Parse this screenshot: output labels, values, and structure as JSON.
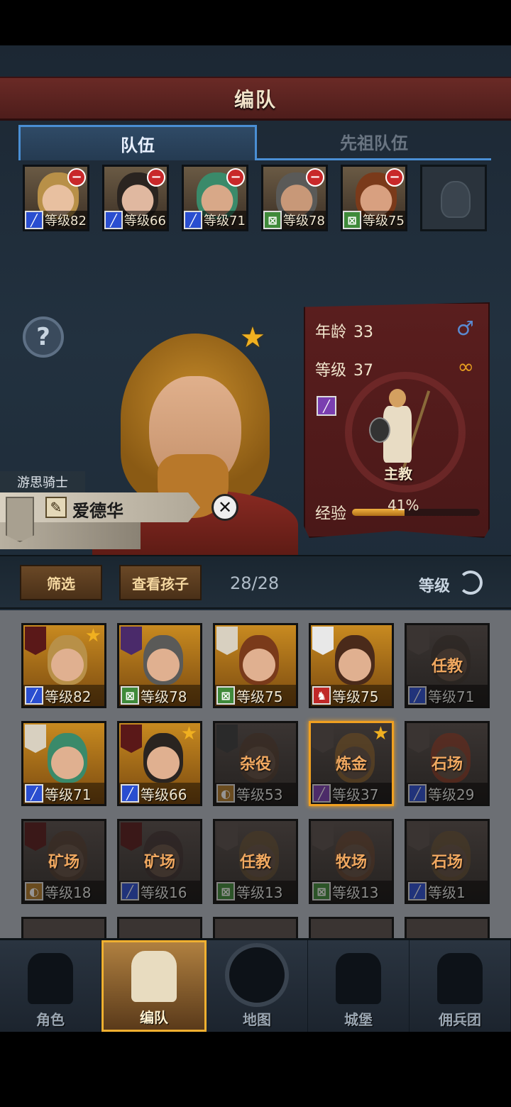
{
  "header": {
    "title": "编队"
  },
  "tabs": [
    {
      "label": "队伍",
      "active": true
    },
    {
      "label": "先祖队伍",
      "active": false
    }
  ],
  "team": [
    {
      "level_text": "等级82",
      "class_icon": "sword-icon",
      "hair": "#b89048",
      "skin": "#e8c0a0"
    },
    {
      "level_text": "等级66",
      "class_icon": "sword-icon",
      "hair": "#2a2420",
      "skin": "#e0b8a0"
    },
    {
      "level_text": "等级71",
      "class_icon": "sword-icon",
      "hair": "#3a8a6a",
      "skin": "#d8a888"
    },
    {
      "level_text": "等级78",
      "class_icon": "shield-icon",
      "hair": "#5a5a58",
      "skin": "#c89878"
    },
    {
      "level_text": "等级75",
      "class_icon": "shield-icon",
      "hair": "#7a3a1a",
      "skin": "#d8a080"
    }
  ],
  "hero": {
    "class_title": "游思骑士",
    "name": "爱德华",
    "age_label": "年龄",
    "age": "33",
    "level_label": "等级",
    "level": "37",
    "job": "主教",
    "exp_label": "经验",
    "exp_percent_text": "41%",
    "exp_fraction": 0.41,
    "gender_icon": "male-icon",
    "ring_icon": "rings-icon"
  },
  "toolbar": {
    "filter_label": "筛选",
    "children_label": "查看孩子",
    "count": "28/28",
    "sort_label": "等级"
  },
  "roster": [
    {
      "level_text": "等级82",
      "class_icon": "sword-icon",
      "star": true,
      "job": "",
      "dim": false,
      "tag_color": "#5a1818",
      "hair": "#b89048"
    },
    {
      "level_text": "等级78",
      "class_icon": "shield-icon",
      "star": false,
      "job": "",
      "dim": false,
      "tag_color": "#4a2a6a",
      "hair": "#5a5a58"
    },
    {
      "level_text": "等级75",
      "class_icon": "shield-icon",
      "star": false,
      "job": "",
      "dim": false,
      "tag_color": "#d8d0c0",
      "hair": "#7a3a1a"
    },
    {
      "level_text": "等级75",
      "class_icon": "horse-icon",
      "star": false,
      "job": "",
      "dim": false,
      "tag_color": "#e8e8e8",
      "hair": "#4a2a1a"
    },
    {
      "level_text": "等级71",
      "class_icon": "sword-icon",
      "star": false,
      "job": "任教",
      "dim": true,
      "tag_color": "#3a3432",
      "hair": "#2a2420"
    },
    {
      "level_text": "等级71",
      "class_icon": "sword-icon",
      "star": false,
      "job": "",
      "dim": false,
      "tag_color": "#d8d0c0",
      "hair": "#3a8a6a"
    },
    {
      "level_text": "等级66",
      "class_icon": "sword-icon",
      "star": true,
      "job": "",
      "dim": false,
      "tag_color": "#5a1818",
      "hair": "#2a2420"
    },
    {
      "level_text": "等级53",
      "class_icon": "shield2-icon",
      "star": false,
      "job": "杂役",
      "dim": true,
      "tag_color": "#2a2a2a",
      "hair": "#3a2a20"
    },
    {
      "level_text": "等级37",
      "class_icon": "staff-icon",
      "star": true,
      "job": "炼金",
      "dim": true,
      "selected": true,
      "tag_color": "#3a3432",
      "hair": "#6a4a20"
    },
    {
      "level_text": "等级29",
      "class_icon": "sword-icon",
      "star": false,
      "job": "石场",
      "dim": true,
      "tag_color": "#3a3432",
      "hair": "#6a2a1a"
    },
    {
      "level_text": "等级18",
      "class_icon": "shield2-icon",
      "star": false,
      "job": "矿场",
      "dim": true,
      "tag_color": "#3a1818",
      "hair": "#3a2a20"
    },
    {
      "level_text": "等级16",
      "class_icon": "sword-icon",
      "star": false,
      "job": "矿场",
      "dim": true,
      "tag_color": "#3a1818",
      "hair": "#2a2020"
    },
    {
      "level_text": "等级13",
      "class_icon": "shield-icon",
      "star": false,
      "job": "任教",
      "dim": true,
      "tag_color": "#3a3432",
      "hair": "#4a3a24"
    },
    {
      "level_text": "等级13",
      "class_icon": "shield-icon",
      "star": false,
      "job": "牧场",
      "dim": true,
      "tag_color": "#3a3432",
      "hair": "#4a3020"
    },
    {
      "level_text": "等级1",
      "class_icon": "sword-icon",
      "star": false,
      "job": "石场",
      "dim": true,
      "tag_color": "#3a3432",
      "hair": "#4a3a24"
    }
  ],
  "nav": [
    {
      "label": "角色",
      "icon": "knight-icon",
      "active": false
    },
    {
      "label": "编队",
      "icon": "helmet-icon",
      "active": true
    },
    {
      "label": "地图",
      "icon": "compass-map-icon",
      "active": false
    },
    {
      "label": "城堡",
      "icon": "castle-icon",
      "active": false
    },
    {
      "label": "佣兵团",
      "icon": "mercenary-banner-icon",
      "active": false
    }
  ],
  "colors": {
    "accent_blue": "#4a8fd4",
    "banner_red": "#6a2a26",
    "star_gold": "#f0b020",
    "remove_red": "#c8282a",
    "selected_orange": "#f0a020"
  }
}
